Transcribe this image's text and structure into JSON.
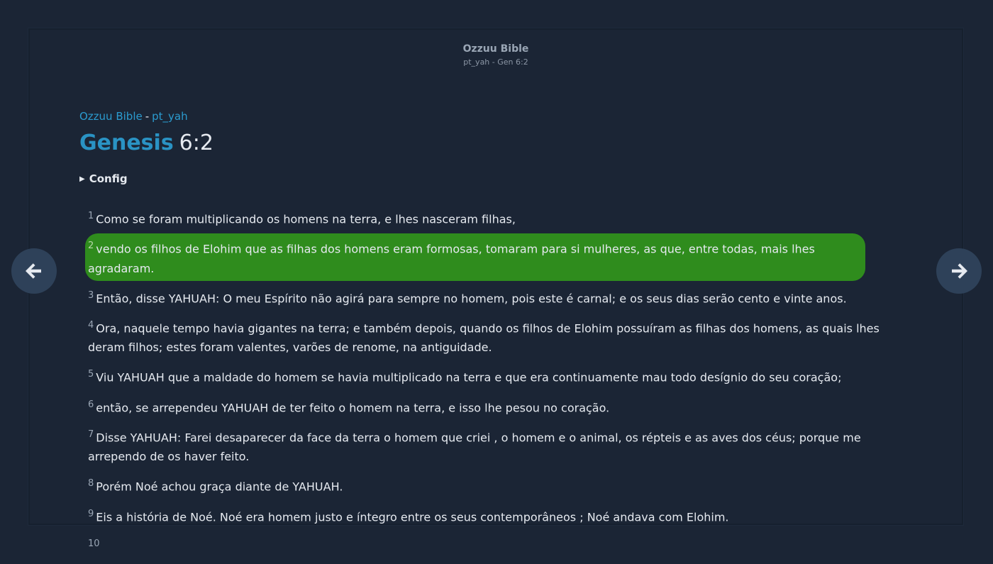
{
  "site": {
    "title": "Ozzuu Bible",
    "subtitle": "pt_yah - Gen 6:2"
  },
  "breadcrumb": {
    "home": "Ozzuu Bible",
    "separator": "-",
    "version": "pt_yah"
  },
  "heading": {
    "book": "Genesis",
    "reference": "6:2"
  },
  "config": {
    "label": "Config",
    "expanded": false
  },
  "verses": [
    {
      "num": "1",
      "text": "Como se foram multiplicando os homens na terra, e lhes nasceram filhas,"
    },
    {
      "num": "2",
      "text": "vendo os filhos de Elohim que as filhas dos homens eram formosas, tomaram para si mulheres, as que, entre todas, mais lhes agradaram.",
      "current": true
    },
    {
      "num": "3",
      "text": "Então, disse YAHUAH: O meu Espírito não agirá para sempre no homem, pois este é carnal; e os seus dias serão cento e vinte anos."
    },
    {
      "num": "4",
      "text": "Ora, naquele tempo havia gigantes na terra; e também depois, quando os filhos de Elohim possuíram as filhas dos homens, as quais lhes deram filhos; estes foram valentes, varões de renome, na antiguidade."
    },
    {
      "num": "5",
      "text": "Viu YAHUAH que a maldade do homem se havia multiplicado na terra e que era continuamente mau todo desígnio do seu coração;"
    },
    {
      "num": "6",
      "text": "então, se arrependeu YAHUAH de ter feito o homem na terra, e isso lhe pesou no coração."
    },
    {
      "num": "7",
      "text": "Disse YAHUAH: Farei desaparecer da face da terra o homem que criei , o homem e o animal, os répteis e as aves dos céus; porque me arrependo de os haver feito."
    },
    {
      "num": "8",
      "text": "Porém Noé achou graça diante de YAHUAH."
    },
    {
      "num": "9",
      "text": "Eis a história de Noé. Noé era homem justo e íntegro entre os seus contemporâneos ; Noé andava com Elohim."
    },
    {
      "num": "10",
      "text": ""
    }
  ],
  "nav": {
    "prev_icon": "arrow-left-icon",
    "next_icon": "arrow-right-icon"
  },
  "colors": {
    "background": "#1b2535",
    "accent": "#2a93c4",
    "highlight": "#2f8c1d",
    "nav_button": "#2e4159"
  }
}
